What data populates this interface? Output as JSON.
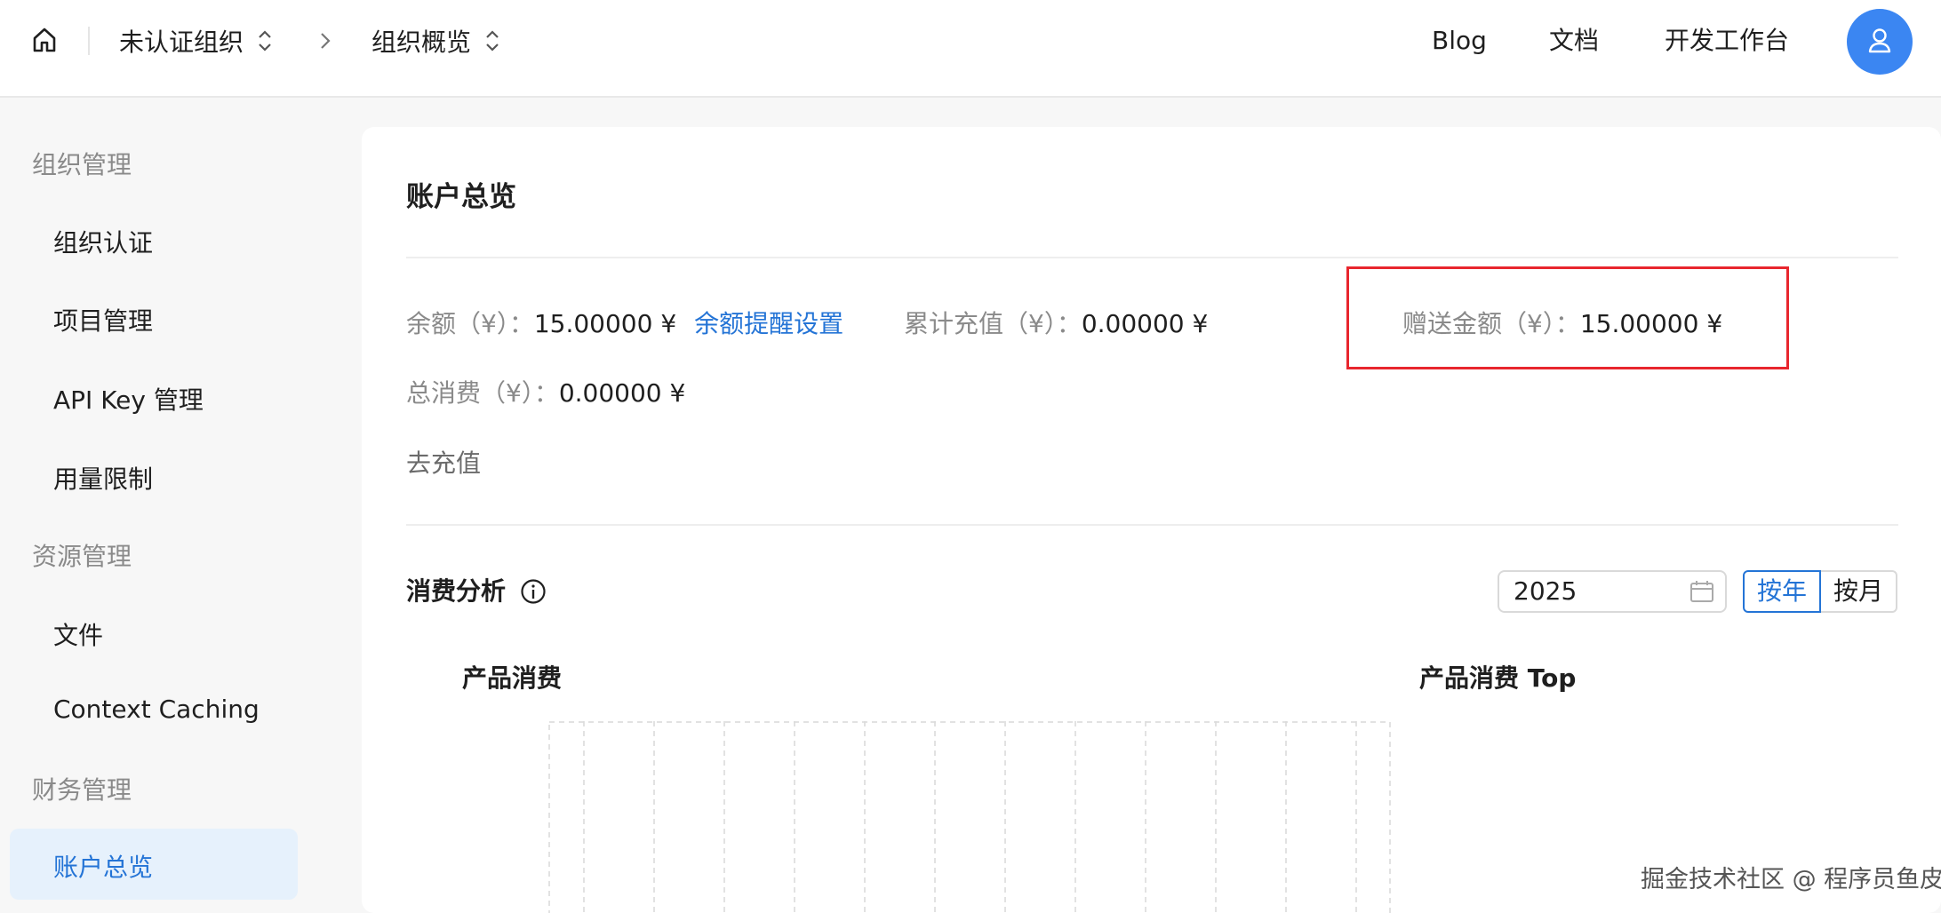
{
  "header": {
    "breadcrumb": [
      {
        "label": "未认证组织"
      },
      {
        "label": "组织概览"
      }
    ],
    "nav": {
      "blog": "Blog",
      "docs": "文档",
      "workbench": "开发工作台"
    },
    "accent_color": "#3b86f2"
  },
  "sidebar": {
    "groups": [
      {
        "label": "组织管理",
        "items": [
          "组织认证",
          "项目管理",
          "API Key 管理",
          "用量限制"
        ]
      },
      {
        "label": "资源管理",
        "items": [
          "文件",
          "Context Caching"
        ]
      },
      {
        "label": "财务管理",
        "items": [
          "账户总览"
        ]
      }
    ],
    "active_item": "账户总览"
  },
  "account": {
    "title": "账户总览",
    "balance": {
      "label": "余额（¥）：",
      "value": "15.00000 ¥",
      "link": "余额提醒设置"
    },
    "total_recharge": {
      "label": "累计充值（¥）：",
      "value": "0.00000 ¥"
    },
    "gift_amount": {
      "label": "赠送金额（¥）：",
      "value": "15.00000 ¥"
    },
    "total_spend": {
      "label": "总消费（¥）：",
      "value": "0.00000 ¥"
    },
    "recharge_link": "去充值"
  },
  "analysis": {
    "title": "消费分析",
    "year": "2025",
    "toggle": {
      "by_year": "按年",
      "by_month": "按月",
      "selected": "按年"
    },
    "product_spend_title": "产品消费",
    "product_top_title": "产品消费 Top"
  },
  "watermark": "掘金技术社区 @ 程序员鱼皮",
  "highlight_color": "#e8262e"
}
